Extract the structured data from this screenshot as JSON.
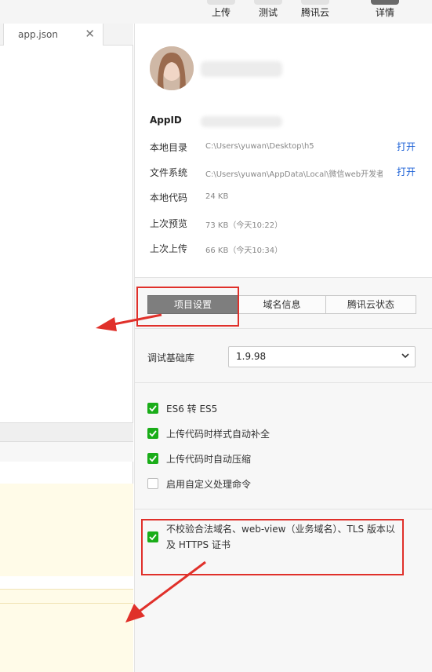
{
  "toolbar": {
    "buttons": [
      {
        "label": "上传"
      },
      {
        "label": "测试"
      },
      {
        "label": "腾讯云"
      },
      {
        "label": "详情"
      }
    ]
  },
  "editor": {
    "tab_name": "app.json",
    "close_glyph": "✕"
  },
  "project": {
    "appid_label": "AppID",
    "rows": [
      {
        "label": "本地目录",
        "value": "C:\\Users\\yuwan\\Desktop\\h5",
        "link": "打开"
      },
      {
        "label": "文件系统",
        "value": "C:\\Users\\yuwan\\AppData\\Local\\微信web开发者工...",
        "link": "打开"
      },
      {
        "label": "本地代码",
        "value": "24 KB"
      },
      {
        "label": "上次预览",
        "value": "73 KB（今天10:22）"
      },
      {
        "label": "上次上传",
        "value": "66 KB（今天10:34）"
      }
    ]
  },
  "tabs": [
    {
      "label": "项目设置",
      "active": true
    },
    {
      "label": "域名信息",
      "active": false
    },
    {
      "label": "腾讯云状态",
      "active": false
    }
  ],
  "base_lib": {
    "label": "调试基础库",
    "value": "1.9.98"
  },
  "options": [
    {
      "label": "ES6 转 ES5",
      "checked": true
    },
    {
      "label": "上传代码时样式自动补全",
      "checked": true
    },
    {
      "label": "上传代码时自动压缩",
      "checked": true
    },
    {
      "label": "启用自定义处理命令",
      "checked": false
    }
  ],
  "domain_check": {
    "label": "不校验合法域名、web-view（业务域名）、TLS 版本以及 HTTPS 证书",
    "checked": true
  },
  "colors": {
    "checkbox": "#1aad19",
    "link": "#1a5fd6",
    "highlight": "#e0302a"
  }
}
